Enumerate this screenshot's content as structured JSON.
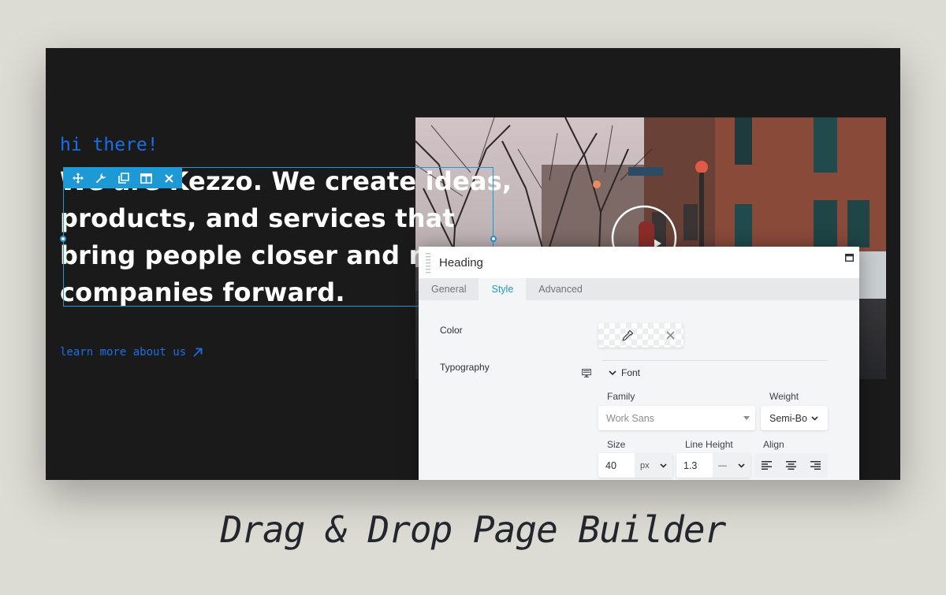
{
  "hero": {
    "eyebrow": "hi there!",
    "headline_lines": [
      "We are Kezzo. We create ideas,",
      "products, and services that",
      "bring people closer and m",
      "companies forward."
    ],
    "link": "learn more about us"
  },
  "panel": {
    "title": "Heading",
    "tabs": [
      "General",
      "Style",
      "Advanced"
    ],
    "active_tab": "Style",
    "color_label": "Color",
    "typography_label": "Typography",
    "font_toggle": "Font",
    "family_label": "Family",
    "family_value": "Work Sans",
    "weight_label": "Weight",
    "weight_value": "Semi-Bo",
    "size_label": "Size",
    "size_value": "40",
    "size_unit": "px",
    "line_height_label": "Line Height",
    "line_height_value": "1.3",
    "line_height_unit": "—",
    "align_label": "Align"
  },
  "caption": "Drag & Drop Page Builder",
  "colors": {
    "accent_blue": "#1a6ee8",
    "selection_blue": "#1d9ad6",
    "stage_bg": "#1a1a1a",
    "page_bg": "#dcdbd4"
  }
}
